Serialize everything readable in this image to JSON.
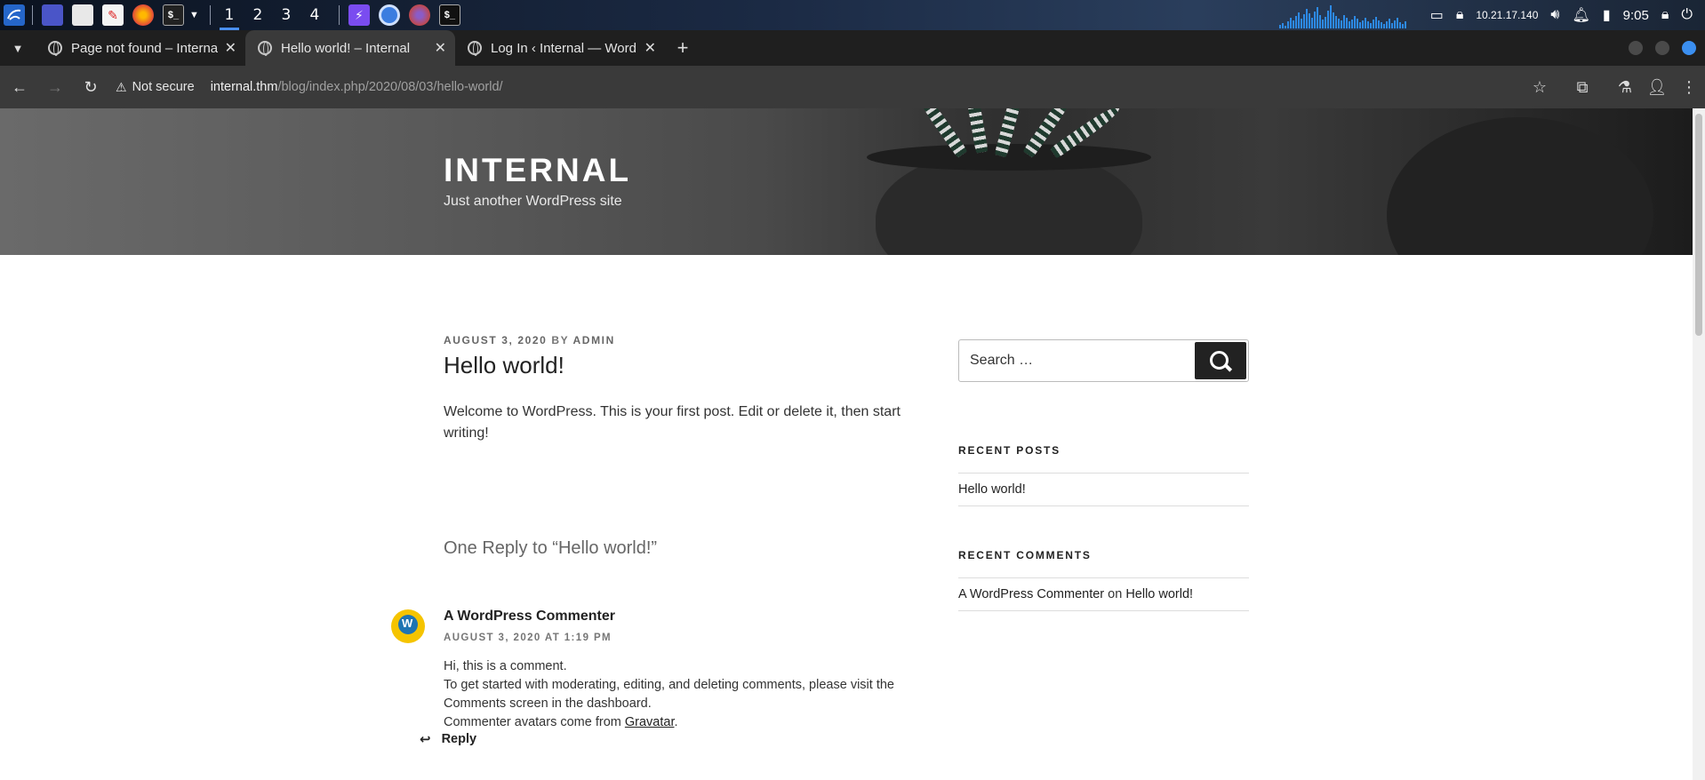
{
  "taskbar": {
    "workspaces": [
      "1",
      "2",
      "3",
      "4"
    ],
    "ip": "10.21.17.140",
    "clock": "9:05",
    "icons": [
      "kali-menu-icon",
      "desktop-icon",
      "file-manager-icon",
      "text-editor-icon",
      "firefox-icon",
      "terminal-icon",
      "burp-icon",
      "chromium-icon",
      "firefox-icon",
      "terminal-icon"
    ]
  },
  "browser": {
    "tabs": [
      {
        "title": "Page not found – Internal"
      },
      {
        "title": "Hello world! – Internal"
      },
      {
        "title": "Log In ‹ Internal — WordPress"
      }
    ],
    "security_label": "Not secure",
    "url_host": "internal.thm",
    "url_path": "/blog/index.php/2020/08/03/hello-world/"
  },
  "site": {
    "title": "INTERNAL",
    "description": "Just another WordPress site"
  },
  "post": {
    "date": "AUGUST 3, 2020",
    "by": "BY",
    "author": "ADMIN",
    "title": "Hello world!",
    "body": "Welcome to WordPress. This is your first post. Edit or delete it, then start writing!"
  },
  "comments": {
    "heading": "One Reply to “Hello world!”",
    "items": [
      {
        "author": "A WordPress Commenter",
        "date": "AUGUST 3, 2020 AT 1:19 PM",
        "line1": "Hi, this is a comment.",
        "line2": "To get started with moderating, editing, and deleting comments, please visit the Comments screen in the dashboard.",
        "line3_prefix": "Commenter avatars come from ",
        "line3_link": "Gravatar",
        "line3_suffix": ".",
        "reply_label": "Reply"
      }
    ]
  },
  "sidebar": {
    "search_placeholder": "Search …",
    "recent_posts_title": "RECENT POSTS",
    "recent_posts": [
      "Hello world!"
    ],
    "recent_comments_title": "RECENT COMMENTS",
    "recent_comment": {
      "author": "A WordPress Commenter",
      "on": "on",
      "post": "Hello world!"
    }
  }
}
